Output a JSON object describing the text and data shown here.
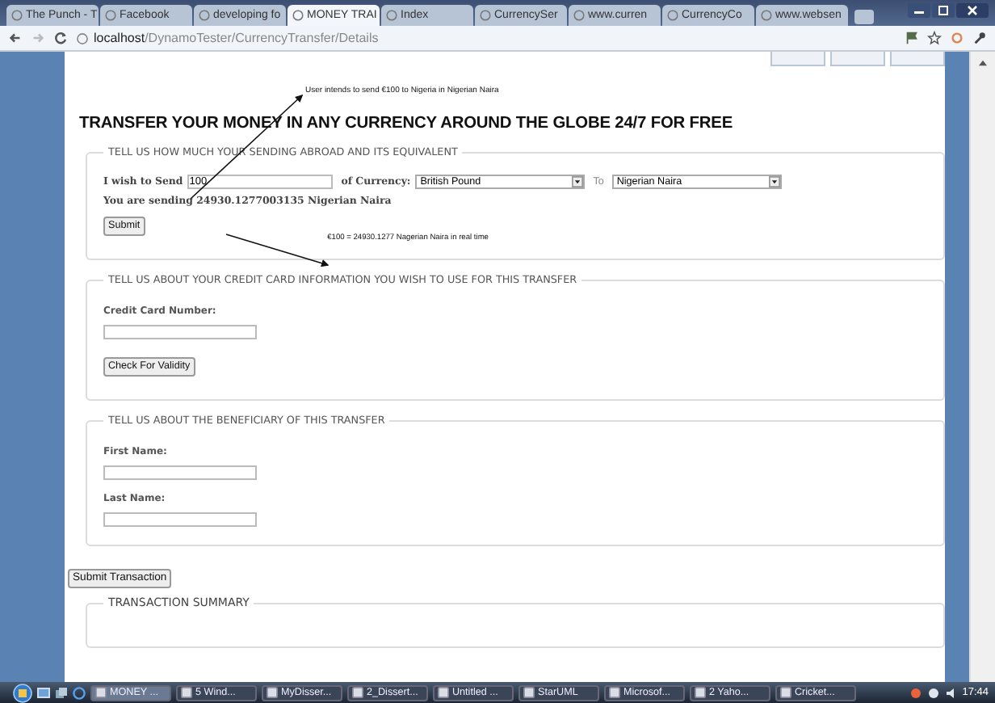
{
  "browser": {
    "tabs": [
      {
        "label": "The Punch - T",
        "selected": false
      },
      {
        "label": "Facebook",
        "selected": false
      },
      {
        "label": "developing fo",
        "selected": false
      },
      {
        "label": "MONEY TRAI",
        "selected": true
      },
      {
        "label": "Index",
        "selected": false
      },
      {
        "label": "CurrencySer",
        "selected": false
      },
      {
        "label": "www.curren",
        "selected": false
      },
      {
        "label": "CurrencyCo",
        "selected": false
      },
      {
        "label": "www.websen",
        "selected": false
      }
    ],
    "address": {
      "host": "localhost",
      "path": "/DynamoTester/CurrencyTransfer/Details"
    }
  },
  "page": {
    "annotations": [
      {
        "text": "User intends to send €100 to Nigeria in Nigerian Naira"
      },
      {
        "text": "€100 = 24930.1277 Nagerian Naira in real time"
      }
    ],
    "heading": "TRANSFER YOUR MONEY IN ANY CURRENCY AROUND THE GLOBE 24/7 FOR FREE",
    "converter": {
      "legend": "TELL US HOW MUCH YOUR SENDING ABROAD AND ITS EQUIVALENT",
      "send_label": "I wish to Send",
      "amount": "100",
      "currency_label": "of Currency:",
      "from": "British Pound",
      "to_label": "To",
      "to": "Nigerian Naira",
      "result": "You are sending 24930.1277003135 Nigerian Naira",
      "button": "Submit"
    },
    "card": {
      "legend": "TELL US ABOUT YOUR CREDIT CARD INFORMATION YOU WISH TO USE FOR THIS TRANSFER",
      "label": "Credit Card Number:",
      "button": "Check For Validity"
    },
    "beneficiary": {
      "legend": "TELL US ABOUT THE BENEFICIARY OF THIS TRANSFER",
      "fields": [
        {
          "label": "First Name:"
        },
        {
          "label": "Last Name:"
        }
      ]
    },
    "submit_button": "Submit Transaction",
    "summary": {
      "legend": "TRANSACTION SUMMARY"
    }
  },
  "taskbar": {
    "items": [
      {
        "label": "MONEY ...",
        "selected": true
      },
      {
        "label": "5 Wind...",
        "selected": false
      },
      {
        "label": "MyDisser...",
        "selected": false
      },
      {
        "label": "2_Dissert...",
        "selected": false
      },
      {
        "label": "Untitled ...",
        "selected": false
      },
      {
        "label": "StarUML",
        "selected": false
      },
      {
        "label": "Microsof...",
        "selected": false
      },
      {
        "label": "2 Yaho...",
        "selected": false
      },
      {
        "label": "Cricket...",
        "selected": false
      }
    ],
    "clock": "17:44"
  }
}
